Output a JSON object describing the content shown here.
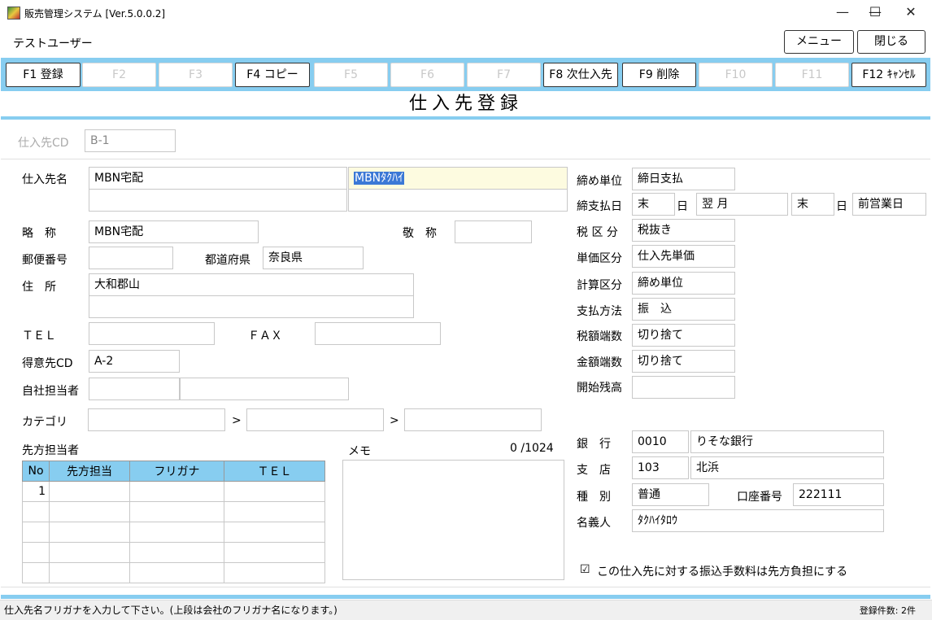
{
  "window": {
    "title": "販売管理システム [Ver.5.0.0.2]",
    "minimize": "—",
    "maximize": "☐",
    "close": "✕"
  },
  "userbar": {
    "user": "テストユーザー",
    "menu_button": "メニュー",
    "close_button": "閉じる"
  },
  "function_keys": [
    {
      "label": "F1 登録",
      "enabled": true
    },
    {
      "label": "F2",
      "enabled": false
    },
    {
      "label": "F3",
      "enabled": false
    },
    {
      "label": "F4 コピー",
      "enabled": true
    },
    {
      "label": "F5",
      "enabled": false
    },
    {
      "label": "F6",
      "enabled": false
    },
    {
      "label": "F7",
      "enabled": false
    },
    {
      "label": "F8 次仕入先",
      "enabled": true
    },
    {
      "label": "F9 削除",
      "enabled": true
    },
    {
      "label": "F10",
      "enabled": false
    },
    {
      "label": "F11",
      "enabled": false
    },
    {
      "label": "F12 ｷｬﾝｾﾙ",
      "enabled": true
    }
  ],
  "page_title": "仕入先登録",
  "header": {
    "supplier_cd_label": "仕入先CD",
    "supplier_cd_value": "B-1"
  },
  "form": {
    "name_label": "仕入先名",
    "name_1": "MBN宅配",
    "name_2": "",
    "kana_1": "MBNﾀｸﾊｲ",
    "kana_2": "",
    "short_label": "略　称",
    "short_value": "MBN宅配",
    "honorific_label": "敬　称",
    "honorific_value": "",
    "postal_label": "郵便番号",
    "postal_value": "",
    "prefecture_label": "都道府県",
    "prefecture_value": "奈良県",
    "address_label": "住　所",
    "address_1": "大和郡山",
    "address_2": "",
    "tel_label": "ＴＥＬ",
    "tel_value": "",
    "fax_label": "ＦＡＸ",
    "fax_value": "",
    "customer_cd_label": "得意先CD",
    "customer_cd_value": "A-2",
    "staff_label": "自社担当者",
    "staff_code": "",
    "staff_name": "",
    "category_label": "カテゴリ",
    "category_1": "",
    "category_2": "",
    "category_3": "",
    "category_sep": ">",
    "contact_label": "先方担当者",
    "memo_label": "メモ",
    "memo_count": "0  /1024",
    "memo_value": ""
  },
  "contacts": {
    "headers": [
      "No",
      "先方担当",
      "フリガナ",
      "ＴＥＬ"
    ],
    "rows": [
      [
        "1",
        "",
        "",
        ""
      ],
      [
        "",
        "",
        "",
        ""
      ],
      [
        "",
        "",
        "",
        ""
      ],
      [
        "",
        "",
        "",
        ""
      ],
      [
        "",
        "",
        "",
        ""
      ]
    ]
  },
  "right": {
    "closing_unit_label": "締め単位",
    "closing_unit_value": "締日支払",
    "closing_pay_label": "締支払日",
    "closing_day": "末",
    "day_char": "日",
    "pay_month": "翌 月",
    "pay_day": "末",
    "day_char2": "日",
    "business_day": "前営業日",
    "tax_class_label": "税 区 分",
    "tax_class_value": "税抜き",
    "price_class_label": "単価区分",
    "price_class_value": "仕入先単価",
    "calc_class_label": "計算区分",
    "calc_class_value": "締め単位",
    "payment_label": "支払方法",
    "payment_value": "振　込",
    "tax_round_label": "税額端数",
    "tax_round_value": "切り捨て",
    "amount_round_label": "金額端数",
    "amount_round_value": "切り捨て",
    "opening_label": "開始残高",
    "opening_value": "",
    "bank_label": "銀　行",
    "bank_code": "0010",
    "bank_name": "りそな銀行",
    "branch_label": "支　店",
    "branch_code": "103",
    "branch_name": "北浜",
    "type_label": "種　別",
    "type_value": "普通",
    "account_label": "口座番号",
    "account_value": "222111",
    "holder_label": "名義人",
    "holder_value": "ﾀｸﾊｲﾀﾛｳ",
    "fee_check": "☑",
    "fee_label": "この仕入先に対する振込手数料は先方負担にする"
  },
  "status": {
    "message": "仕入先名フリガナを入力して下さい。(上段は会社のフリガナ名になります。)",
    "count": "登録件数: 2件"
  }
}
